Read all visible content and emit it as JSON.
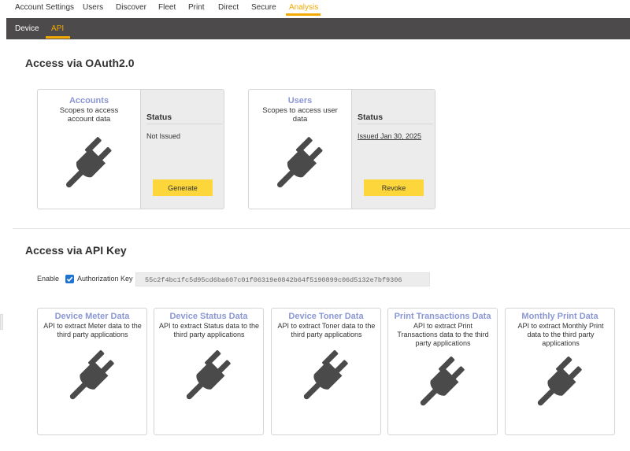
{
  "topnav": {
    "tabs": [
      {
        "label": "Account Settings",
        "active": false
      },
      {
        "label": "Users",
        "active": false
      },
      {
        "label": "Discover",
        "active": false
      },
      {
        "label": "Fleet",
        "active": false
      },
      {
        "label": "Print",
        "active": false
      },
      {
        "label": "Direct",
        "active": false
      },
      {
        "label": "Secure",
        "active": false
      },
      {
        "label": "Analysis",
        "active": true
      }
    ]
  },
  "subnav": {
    "tabs": [
      {
        "label": "Device",
        "active": false
      },
      {
        "label": "API",
        "active": true
      }
    ]
  },
  "oauth": {
    "heading": "Access via OAuth2.0",
    "cards": [
      {
        "title": "Accounts",
        "description": "Scopes to access account data",
        "status_label": "Status",
        "status_value": "Not Issued",
        "button_label": "Generate"
      },
      {
        "title": "Users",
        "description": "Scopes to access user data",
        "status_label": "Status",
        "status_value": "Issued Jan 30, 2025",
        "button_label": "Revoke"
      }
    ]
  },
  "apikey": {
    "heading": "Access via API Key",
    "enable_label": "Enable",
    "enabled": true,
    "auth_key_label": "Authorization Key",
    "auth_key_value": "55c2f4bc1fc5d95cd6ba607c01f06319e0842b64f5190899c06d5132e7bf9306",
    "cards": [
      {
        "title": "Device Meter Data",
        "description": "API to extract Meter data to the third party applications"
      },
      {
        "title": "Device Status Data",
        "description": "API to extract Status data to the third party applications"
      },
      {
        "title": "Device Toner Data",
        "description": "API to extract Toner data to the third party applications"
      },
      {
        "title": "Print Transactions Data",
        "description": "API to extract Print Transactions data to the third party applications"
      },
      {
        "title": "Monthly Print Data",
        "description": "API to extract Monthly Print data to the third party applications"
      }
    ]
  },
  "colors": {
    "accent": "#f2a900",
    "subnav_bg": "#4c4a4a",
    "card_title": "#8b97d4",
    "button": "#fcd63a",
    "checkbox": "#1f73d1",
    "icon": "#4a4a4a"
  },
  "icons": {
    "plug": "plug-icon",
    "checkbox": "checkmark-icon"
  }
}
